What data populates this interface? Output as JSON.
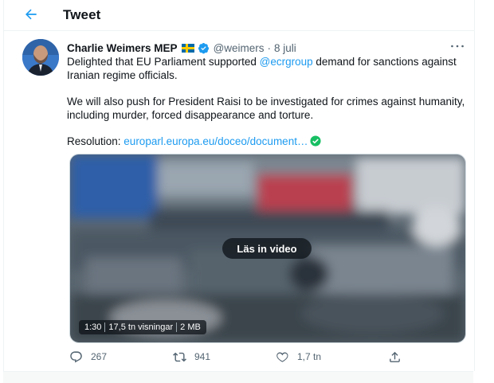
{
  "header": {
    "title": "Tweet",
    "back_icon": "back-arrow-icon"
  },
  "author": {
    "display_name": "Charlie Weimers MEP",
    "flag_icon": "sweden-flag-icon",
    "verified_icon": "verified-badge-icon",
    "handle": "@weimers",
    "separator": "·",
    "date": "8 juli"
  },
  "more_label": "···",
  "tweet": {
    "p1_before": "Delighted that EU Parliament supported ",
    "p1_mention": "@ecrgroup",
    "p1_after": " demand for sanctions against Iranian regime officials.",
    "p2": "We will also push for President Raisi to be investigated for crimes against humanity, including murder, forced disappearance and torture.",
    "p3_label": "Resolution: ",
    "p3_link": "europarl.europa.eu/doceo/document…",
    "p3_icon": "check-circle-icon"
  },
  "video": {
    "overlay_label": "Läs in video",
    "duration": "1:30",
    "views": "17,5 tn visningar",
    "size": "2 MB"
  },
  "actions": {
    "reply_count": "267",
    "retweet_count": "941",
    "like_count": "1,7 tn"
  },
  "colors": {
    "accent": "#1d9bf0",
    "verified": "#1d9bf0",
    "green_check": "#17bf63",
    "text_secondary": "#536471"
  }
}
